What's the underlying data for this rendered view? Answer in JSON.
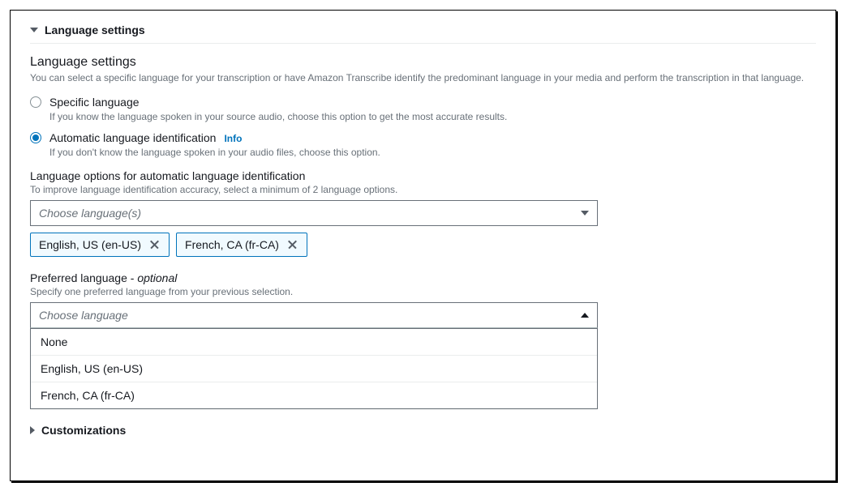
{
  "section_language_settings": {
    "title": "Language settings",
    "block_title": "Language settings",
    "description": "You can select a specific language for your transcription or have Amazon Transcribe identify the predominant language in your media and perform the transcription in that language.",
    "radios": {
      "specific": {
        "label": "Specific language",
        "sub": "If you know the language spoken in your source audio, choose this option to get the most accurate results."
      },
      "auto": {
        "label": "Automatic language identification",
        "info": "Info",
        "sub": "If you don't know the language spoken in your audio files, choose this option."
      }
    },
    "lang_options": {
      "label": "Language options for automatic language identification",
      "desc": "To improve language identification accuracy, select a minimum of 2 language options.",
      "placeholder": "Choose language(s)",
      "tokens": [
        "English, US (en-US)",
        "French, CA (fr-CA)"
      ]
    },
    "preferred": {
      "label_main": "Preferred language",
      "label_sep": " - ",
      "label_optional": "optional",
      "desc": "Specify one preferred language from your previous selection.",
      "placeholder": "Choose language",
      "options": [
        "None",
        "English, US (en-US)",
        "French, CA (fr-CA)"
      ]
    }
  },
  "section_customizations": {
    "title": "Customizations"
  }
}
